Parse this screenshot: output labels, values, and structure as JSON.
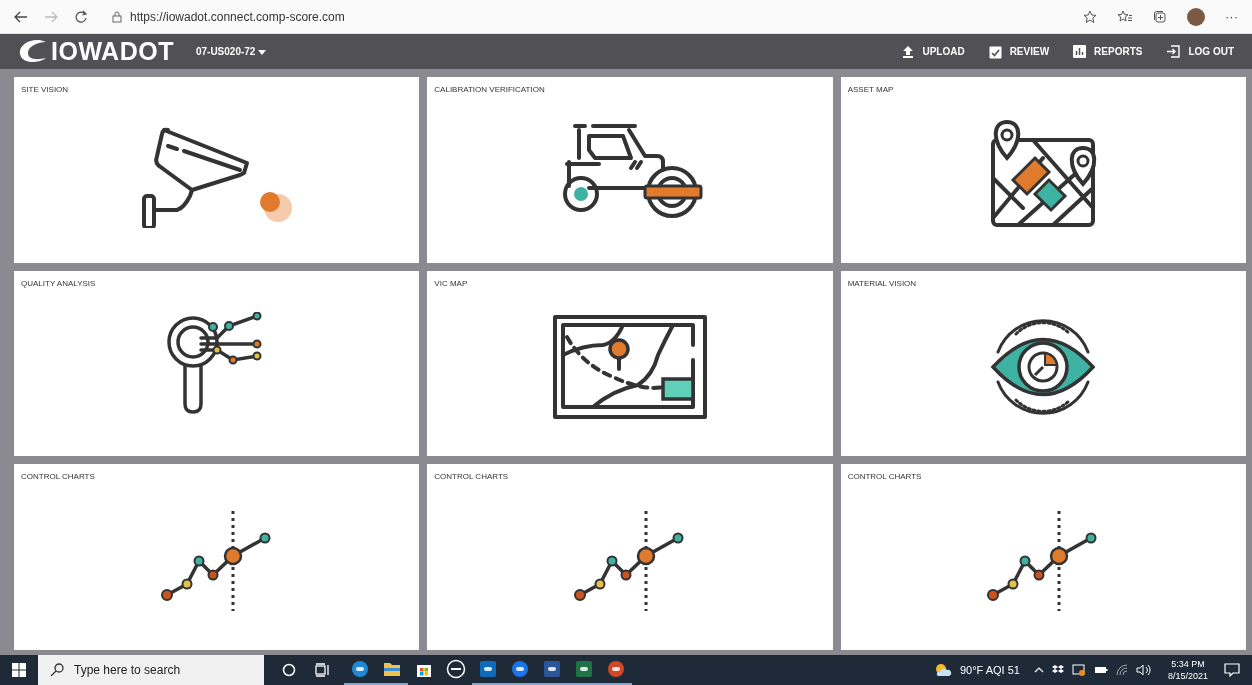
{
  "browser": {
    "url": "https://iowadot.connect.comp-score.com",
    "menu": "···"
  },
  "header": {
    "logo": "IOWADOT",
    "project": "07-US020-72",
    "nav": [
      {
        "label": "UPLOAD",
        "kind": "upload"
      },
      {
        "label": "REVIEW",
        "kind": "review"
      },
      {
        "label": "REPORTS",
        "kind": "reports"
      },
      {
        "label": "LOG OUT",
        "kind": "logout"
      }
    ]
  },
  "cards": [
    {
      "title": "SITE VISION",
      "kind": "camera"
    },
    {
      "title": "CALIBRATION VERIFICATION",
      "kind": "roller"
    },
    {
      "title": "ASSET MAP",
      "kind": "assetmap"
    },
    {
      "title": "QUALITY ANALYSIS",
      "kind": "quality"
    },
    {
      "title": "VIC MAP",
      "kind": "vicmap"
    },
    {
      "title": "MATERIAL VISION",
      "kind": "eye"
    },
    {
      "title": "CONTROL CHARTS",
      "kind": "chart"
    },
    {
      "title": "CONTROL CHARTS",
      "kind": "chart"
    },
    {
      "title": "CONTROL CHARTS",
      "kind": "chart"
    }
  ],
  "taskbar": {
    "search": {
      "placeholder": "Type here to search"
    },
    "apps": [
      {
        "kind": "edge",
        "running": true
      },
      {
        "kind": "folder",
        "running": true
      },
      {
        "kind": "store",
        "running": false
      },
      {
        "kind": "dell",
        "running": false
      },
      {
        "kind": "outlook",
        "running": true
      },
      {
        "kind": "teamviewer",
        "running": true
      },
      {
        "kind": "word",
        "running": true
      },
      {
        "kind": "excel",
        "running": true
      },
      {
        "kind": "powerpoint",
        "running": true
      }
    ],
    "weather": "90°F AQI 51",
    "time": "5:34 PM",
    "date": "8/15/2021"
  }
}
